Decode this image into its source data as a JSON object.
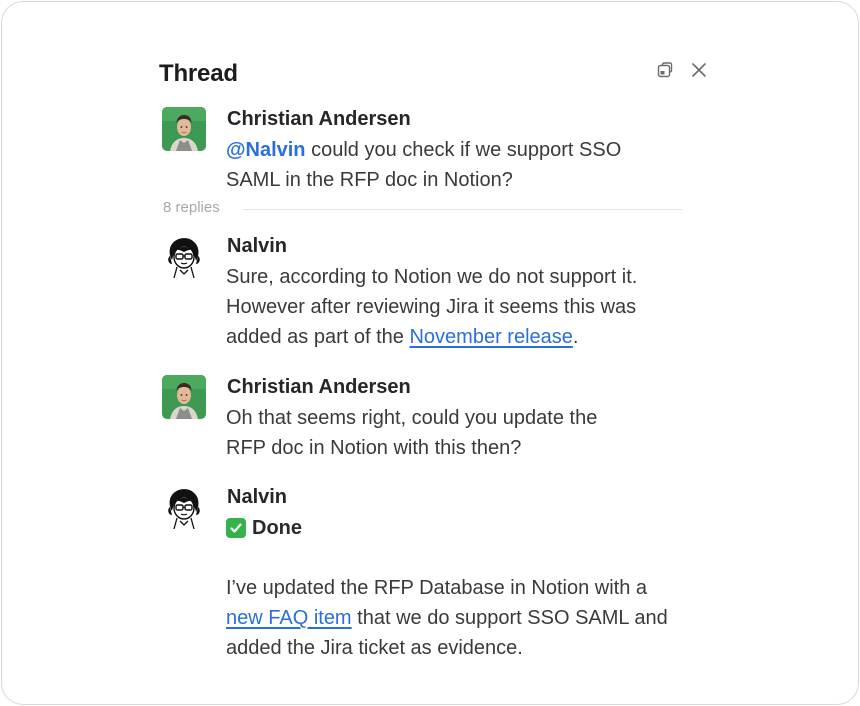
{
  "header": {
    "title": "Thread",
    "popout_icon": "open-in-window-icon",
    "close_icon": "close-icon"
  },
  "root_message": {
    "author": "Christian Andersen",
    "mention": "@Nalvin",
    "line1_rest": " could you check if we support SSO",
    "line2": "SAML in the RFP doc in Notion?"
  },
  "replies_label": "8 replies",
  "messages": [
    {
      "author": "Nalvin",
      "line1": "Sure, according to Notion we do not support it.",
      "line2": "However after reviewing Jira it seems this was",
      "line3_before": "added as part of the ",
      "link": "November release",
      "line3_after": "."
    },
    {
      "author": "Christian Andersen",
      "line1": "Oh that seems right, could you update the",
      "line2": "RFP doc in Notion with this then?"
    },
    {
      "author": "Nalvin",
      "done_icon": "check-mark-button-icon",
      "done": "Done",
      "para_line1": "I’ve updated the RFP Database in Notion with a",
      "para_link": "new FAQ item",
      "para_line2_rest": " that we do support SSO SAML and",
      "para_line3": "added the Jira ticket as evidence."
    }
  ],
  "colors": {
    "link": "#2a6fdb",
    "avatar_bg": "#3e9a52",
    "check_bg": "#35b24a"
  }
}
